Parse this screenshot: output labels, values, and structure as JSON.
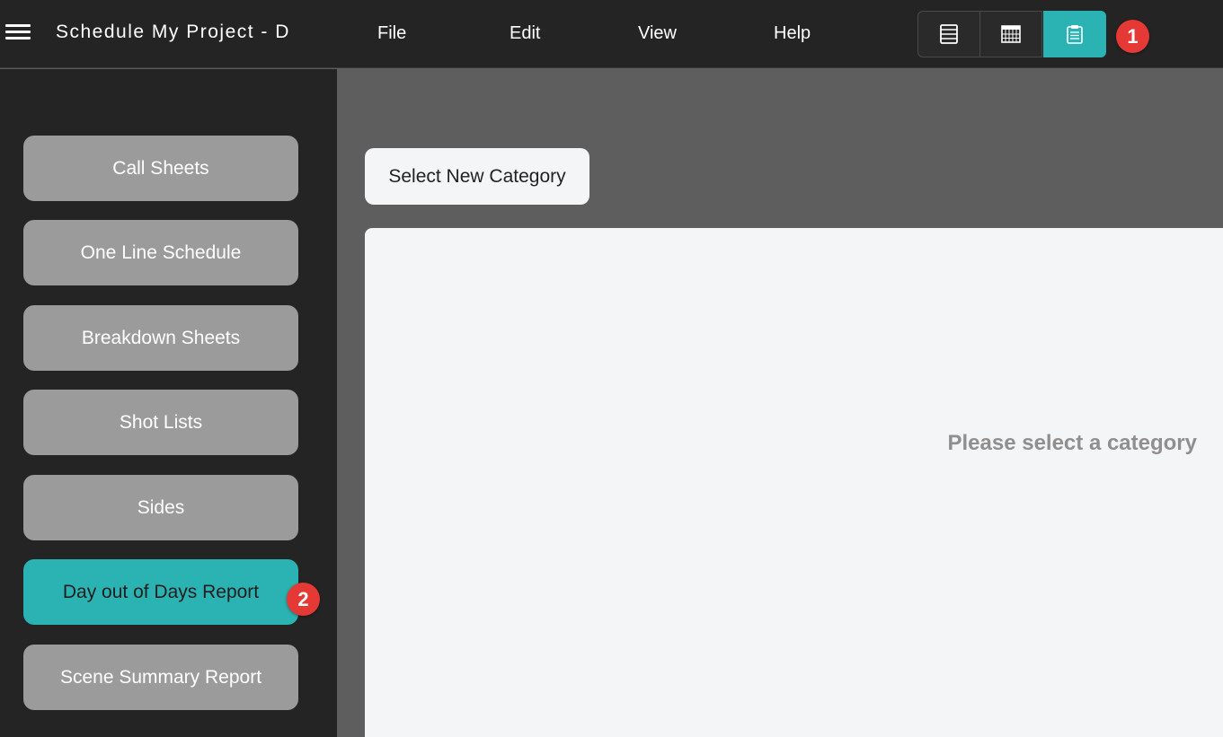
{
  "header": {
    "title": "Schedule My Project - D",
    "menu": [
      "File",
      "Edit",
      "View",
      "Help"
    ]
  },
  "view_buttons": [
    {
      "icon": "list-view-icon",
      "active": false
    },
    {
      "icon": "calendar-grid-icon",
      "active": false
    },
    {
      "icon": "clipboard-icon",
      "active": true
    }
  ],
  "badges": [
    "1",
    "2"
  ],
  "sidebar": {
    "items": [
      {
        "label": "Call Sheets",
        "active": false
      },
      {
        "label": "One Line Schedule",
        "active": false
      },
      {
        "label": "Breakdown Sheets",
        "active": false
      },
      {
        "label": "Shot Lists",
        "active": false
      },
      {
        "label": "Sides",
        "active": false
      },
      {
        "label": "Day out of Days Report",
        "active": true
      },
      {
        "label": "Scene Summary Report",
        "active": false
      }
    ]
  },
  "main": {
    "select_button": "Select New Category",
    "placeholder": "Please select a category"
  },
  "colors": {
    "accent": "#2bb2b2",
    "topbar": "#242424",
    "sidebar": "#242424",
    "sidebar_button": "#9b9b9b",
    "badge": "#e53935",
    "panel": "#f4f5f7"
  }
}
